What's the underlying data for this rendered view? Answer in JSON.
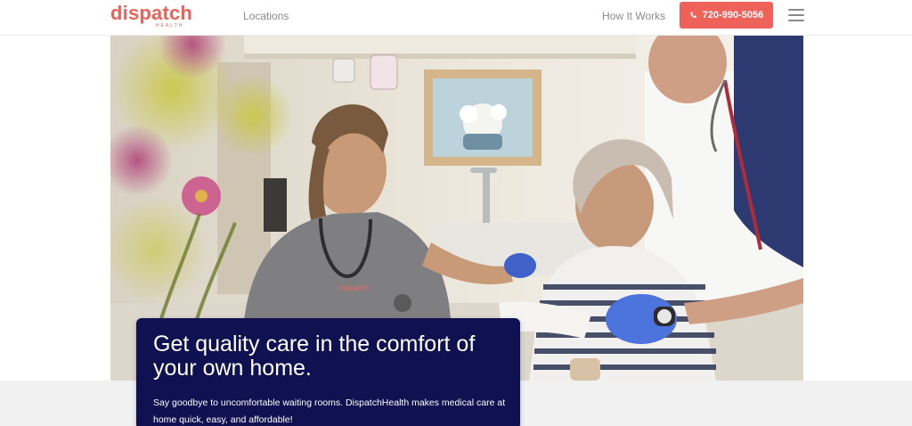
{
  "header": {
    "logo_text": "dispatch",
    "logo_subtext": "HEALTH",
    "nav": {
      "locations": "Locations",
      "how_it_works": "How It Works"
    },
    "phone": "720-990-5056",
    "menu_icon": "hamburger-menu-icon"
  },
  "hero": {
    "headline": "Get quality care in the comfort of your own home.",
    "body": "Say goodbye to uncomfortable waiting rooms. DispatchHealth makes medical care at home quick, easy, and affordable!",
    "scrub_logo": "dispatch"
  },
  "colors": {
    "brand": "#ee6259",
    "card_bg": "#0f1150",
    "nav_text": "#8a8a8a"
  }
}
